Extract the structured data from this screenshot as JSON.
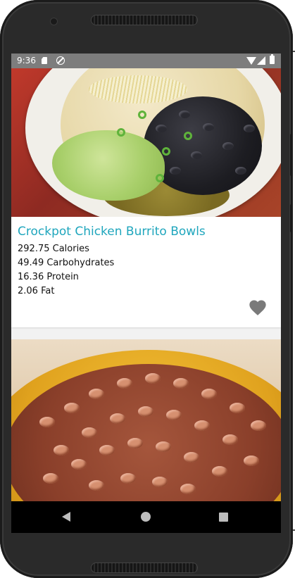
{
  "status_bar": {
    "time": "9:36",
    "icons": [
      "sim-card-icon",
      "do-not-disturb-icon",
      "wifi-icon",
      "signal-icon",
      "battery-icon"
    ]
  },
  "recipes": [
    {
      "title": "Crockpot Chicken Burrito Bowls",
      "calories": "292.75 Calories",
      "carbohydrates": "49.49 Carbohydrates",
      "protein": "16.36 Protein",
      "fat": "2.06 Fat",
      "favorite_icon": "heart-icon"
    }
  ],
  "nav_bar": {
    "icons": [
      "back-icon",
      "home-icon",
      "recents-icon"
    ]
  },
  "colors": {
    "title": "#1fa6bd",
    "status_bar": "#7d7d7d",
    "nav_bar": "#000000",
    "heart": "#7a7a7a"
  }
}
